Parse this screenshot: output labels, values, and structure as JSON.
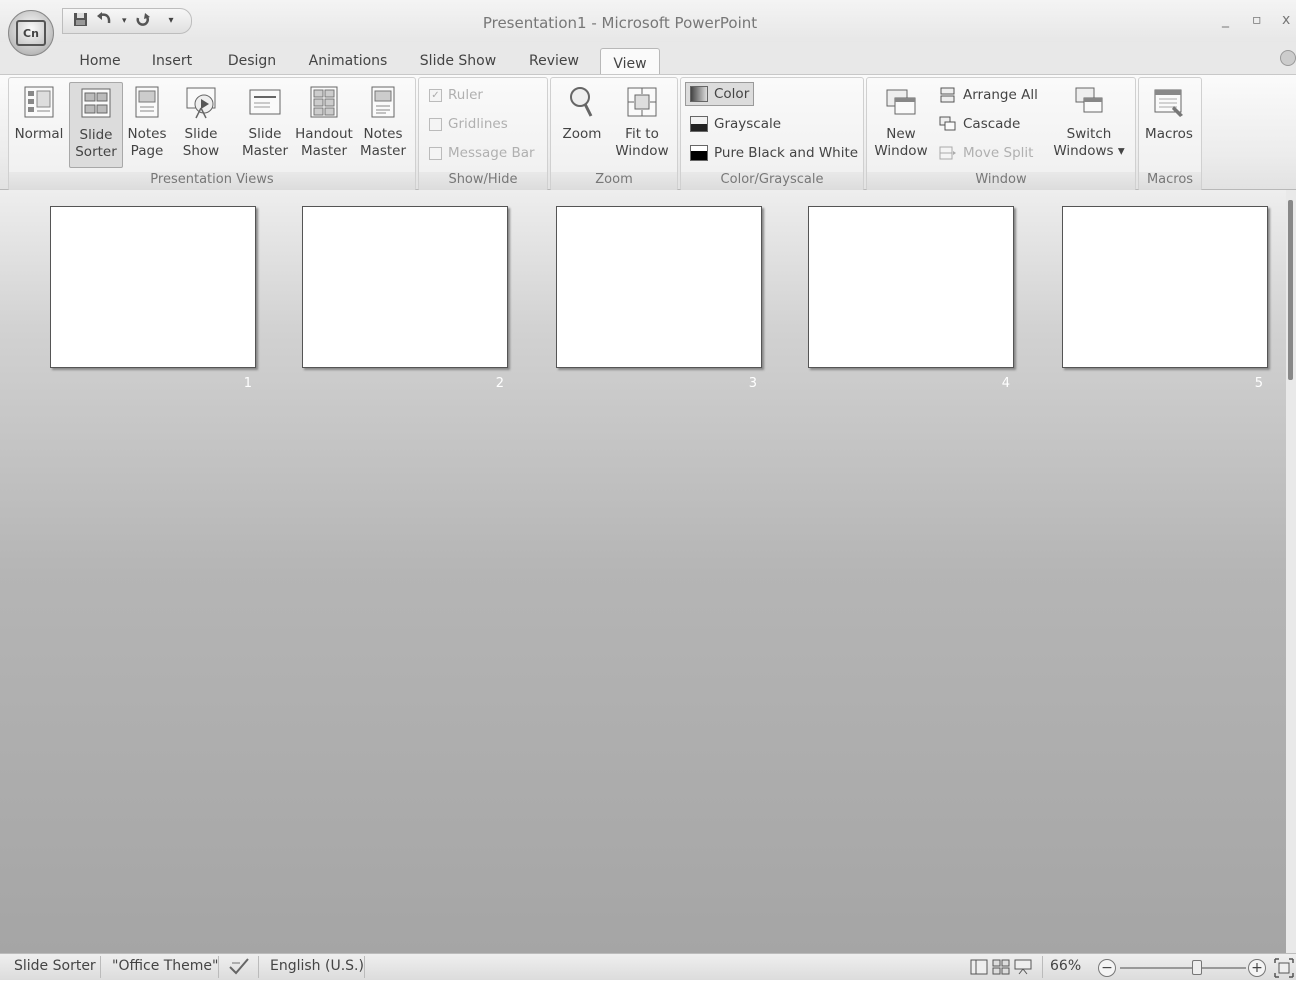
{
  "window": {
    "title": "Presentation1 - Microsoft PowerPoint",
    "minimize_glyph": "_",
    "restore_glyph": "▫",
    "close_glyph": "x"
  },
  "quick_access": {
    "office_logo": "Cn",
    "save_icon": "floppy-disk",
    "undo_icon": "undo",
    "redo_icon": "redo",
    "customize_glyph": "▾"
  },
  "tabs": [
    "Home",
    "Insert",
    "Design",
    "Animations",
    "Slide Show",
    "Review",
    "View"
  ],
  "active_tab": "View",
  "ribbon": {
    "presentation_views": {
      "label": "Presentation Views",
      "buttons": [
        {
          "l1": "Normal",
          "l2": ""
        },
        {
          "l1": "Slide",
          "l2": "Sorter"
        },
        {
          "l1": "Notes",
          "l2": "Page"
        },
        {
          "l1": "Slide",
          "l2": "Show"
        },
        {
          "l1": "Slide",
          "l2": "Master"
        },
        {
          "l1": "Handout",
          "l2": "Master"
        },
        {
          "l1": "Notes",
          "l2": "Master"
        }
      ],
      "selected": "Slide Sorter"
    },
    "show_hide": {
      "label": "Show/Hide",
      "ruler": "Ruler",
      "gridlines": "Gridlines",
      "message_bar": "Message Bar",
      "ruler_checked": true
    },
    "zoom": {
      "label": "Zoom",
      "zoom_btn": "Zoom",
      "fit_l1": "Fit to",
      "fit_l2": "Window"
    },
    "color_grayscale": {
      "label": "Color/Grayscale",
      "color": "Color",
      "grayscale": "Grayscale",
      "pure_bw": "Pure Black and White"
    },
    "window": {
      "label": "Window",
      "new_l1": "New",
      "new_l2": "Window",
      "arrange_all": "Arrange All",
      "cascade": "Cascade",
      "move_split": "Move Split",
      "switch_l1": "Switch",
      "switch_l2": "Windows ▾"
    },
    "macros": {
      "label": "Macros",
      "macros_btn": "Macros"
    }
  },
  "slides": [
    "1",
    "2",
    "3",
    "4",
    "5"
  ],
  "status": {
    "view": "Slide Sorter",
    "theme": "\"Office Theme\"",
    "language": "English (U.S.)",
    "zoom": "66%",
    "zoom_out": "−",
    "zoom_in": "+"
  }
}
